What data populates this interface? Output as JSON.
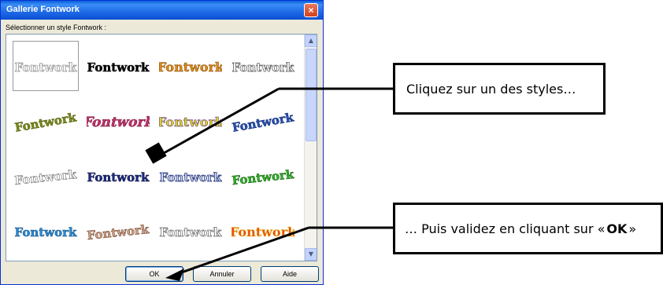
{
  "dialog": {
    "title": "Gallerie Fontwork",
    "close_glyph": "×",
    "prompt": "Sélectionner un style Fontwork :",
    "buttons": {
      "ok": "OK",
      "cancel": "Annuler",
      "help": "Aide"
    },
    "scroll_up": "▲",
    "scroll_down": "▼"
  },
  "gallery": {
    "word": "Fontwork",
    "tiles": [
      {
        "label": "Fontwork",
        "fill": "#ffffff",
        "stroke": "#9a9a9a",
        "style": "outline"
      },
      {
        "label": "Fontwork",
        "fill": "#000000",
        "stroke": "#000000",
        "style": "bold"
      },
      {
        "label": "Fontwork",
        "fill": "#d98a1c",
        "stroke": "#8a4a00",
        "style": "gold"
      },
      {
        "label": "Fontwork",
        "fill": "#ffffff",
        "stroke": "#666666",
        "style": "outline"
      },
      {
        "label": "Fontwork",
        "fill": "#7c8a1c",
        "stroke": "#4a5500",
        "style": "slant"
      },
      {
        "label": "Fontwork",
        "fill": "#c2306a",
        "stroke": "#6a0d30",
        "style": "fan"
      },
      {
        "label": "Fontwork",
        "fill": "#d9d21c",
        "stroke": "#5a2a8a",
        "style": "gold"
      },
      {
        "label": "Fontwork",
        "fill": "#2a4fb0",
        "stroke": "#0b2a70",
        "style": "slant"
      },
      {
        "label": "Fontwork",
        "fill": "#ffffff",
        "stroke": "#555555",
        "style": "arch"
      },
      {
        "label": "Fontwork",
        "fill": "#1d2a80",
        "stroke": "#0a0f40",
        "style": "bold"
      },
      {
        "label": "Fontwork",
        "fill": "#cfd8f0",
        "stroke": "#2a3a80",
        "style": "outline"
      },
      {
        "label": "Fontwork",
        "fill": "#2fb02a",
        "stroke": "#0a5a00",
        "style": "arch"
      },
      {
        "label": "Fontwork",
        "fill": "#2a8ad0",
        "stroke": "#0b4a80",
        "style": "plain"
      },
      {
        "label": "Fontwork",
        "fill": "#c9a089",
        "stroke": "#6a3a20",
        "style": "arch"
      },
      {
        "label": "Fontwork",
        "fill": "#ffffff",
        "stroke": "#777777",
        "style": "outline"
      },
      {
        "label": "Fontwork",
        "fill": "#e8501c",
        "stroke": "#e8c01c",
        "style": "gold"
      }
    ]
  },
  "callouts": {
    "step1": "Cliquez sur un des styles…",
    "step2_prefix": "… Puis validez en cliquant sur « ",
    "step2_ok": "OK",
    "step2_suffix": " »"
  }
}
